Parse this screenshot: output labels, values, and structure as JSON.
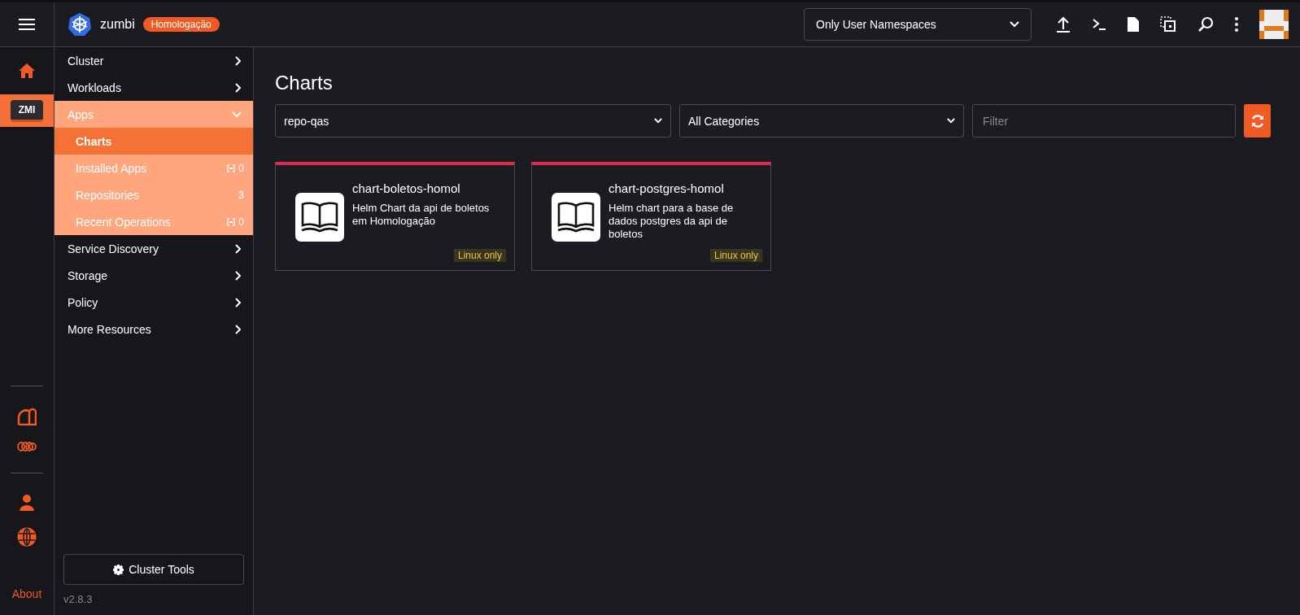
{
  "header": {
    "cluster_name": "zumbi",
    "env_badge": "Homologação",
    "namespace_filter": "Only User Namespaces"
  },
  "rail": {
    "clusters": [
      {
        "label": "ZMI",
        "selected": true
      }
    ],
    "about": "About"
  },
  "nav": [
    {
      "label": "Cluster",
      "expanded": false
    },
    {
      "label": "Workloads",
      "expanded": false
    },
    {
      "label": "Apps",
      "expanded": true,
      "children": [
        {
          "label": "Charts",
          "selected": true,
          "kind": "none"
        },
        {
          "label": "Installed Apps",
          "selected": false,
          "kind": "resource",
          "count": "0"
        },
        {
          "label": "Repositories",
          "selected": false,
          "kind": "plain",
          "count": "3"
        },
        {
          "label": "Recent Operations",
          "selected": false,
          "kind": "resource",
          "count": "0"
        }
      ]
    },
    {
      "label": "Service Discovery",
      "expanded": false
    },
    {
      "label": "Storage",
      "expanded": false
    },
    {
      "label": "Policy",
      "expanded": false
    },
    {
      "label": "More Resources",
      "expanded": false
    }
  ],
  "cluster_tools": "Cluster Tools",
  "version": "v2.8.3",
  "page": {
    "title": "Charts",
    "repo_select": "repo-qas",
    "category_select": "All Categories",
    "filter": {
      "placeholder": "Filter"
    }
  },
  "charts": [
    {
      "name": "chart-boletos-homol",
      "description": "Helm Chart da api de boletos em Homologação",
      "tag": "Linux only"
    },
    {
      "name": "chart-postgres-homol",
      "description": "Helm chart para a base de dados postgres da api de boletos",
      "tag": "Linux only"
    }
  ]
}
